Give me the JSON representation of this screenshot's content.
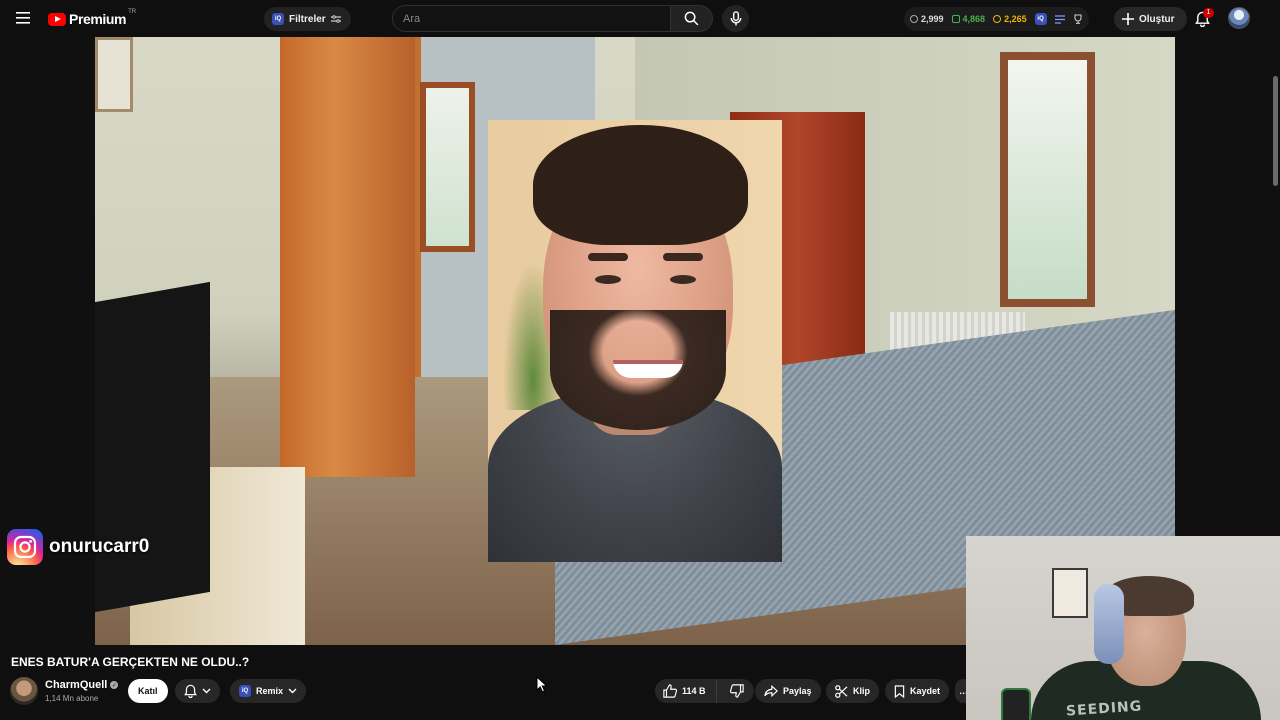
{
  "topbar": {
    "logo_text": "Premium",
    "logo_country": "TR",
    "filters_label": "Filtreler",
    "search_placeholder": "Ara",
    "stats": [
      {
        "value": "2,999",
        "color": "#aaaaaa"
      },
      {
        "value": "4,868",
        "color": "#4caf50"
      },
      {
        "value": "2,265",
        "color": "#f0b400"
      }
    ],
    "create_label": "Oluştur",
    "notification_count": "1"
  },
  "video": {
    "overlay_instagram_handle": "onurucarr0"
  },
  "info": {
    "title": "ENES BATUR'A GERÇEKTEN NE OLDU..?",
    "channel_name": "CharmQuell",
    "channel_subs": "1,14 Mn abone",
    "join_label": "Katıl",
    "remix_label": "Remix",
    "like_count": "114 B",
    "share_label": "Paylaş",
    "clip_label": "Klip",
    "save_label": "Kaydet"
  },
  "webcam": {
    "shirt_text": "SEEDING"
  },
  "colors": {
    "accent_red": "#ff0000",
    "background": "#0f0f0f",
    "pill": "#272727"
  },
  "icons": [
    "menu-icon",
    "filters-icon",
    "search-icon",
    "mic-icon",
    "plus-icon",
    "bell-icon",
    "instagram-icon",
    "like-icon",
    "dislike-icon",
    "share-icon",
    "clip-icon",
    "save-icon",
    "chevron-down-icon",
    "verified-icon"
  ]
}
